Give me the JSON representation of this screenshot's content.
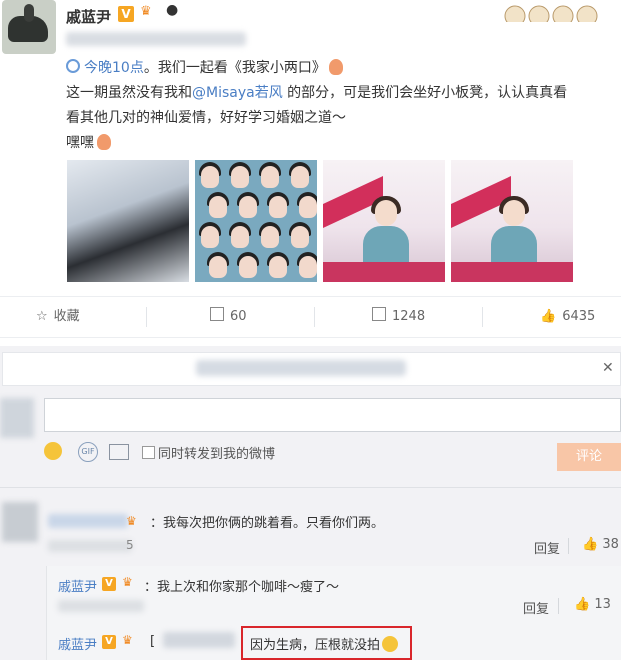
{
  "post": {
    "username": "戚蓝尹",
    "v_badge": "V",
    "tag_prefix": "今晚10点",
    "line1_rest": "。我们一起看《我家小两口》",
    "line2_a": "这一期虽然没有我和",
    "mention": "@Misaya若风",
    "line2_b": " 的部分，可是我们会坐好小板凳，认认真真看",
    "line3": "看其他几对的神仙爱情，好好学习婚姻之道～",
    "line4": "嘿嘿"
  },
  "actions": {
    "favorite": "收藏",
    "repost": "60",
    "comment": "1248",
    "like": "6435"
  },
  "composer": {
    "forward_label": "同时转发到我的微博",
    "submit_label": "评论",
    "gif_label": "GIF"
  },
  "comments": {
    "c1_text": "：我每次把你俩的跳着看。只看你们两。",
    "c1_reply": "回复",
    "c1_likes": "38",
    "c1_time_tail": "5",
    "r1_name": "戚蓝尹",
    "r1_text": "：我上次和你家那个咖啡～瘦了～",
    "r1_reply": "回复",
    "r1_likes": "13",
    "r2_name": "戚蓝尹",
    "r2_bracket": "[",
    "r2_text": "因为生病，压根就没拍"
  },
  "colors": {
    "link": "#4a7ec4",
    "submit_bg": "#f8c6a7",
    "highlight_border": "#d9262b",
    "badge": "#f6a623"
  }
}
